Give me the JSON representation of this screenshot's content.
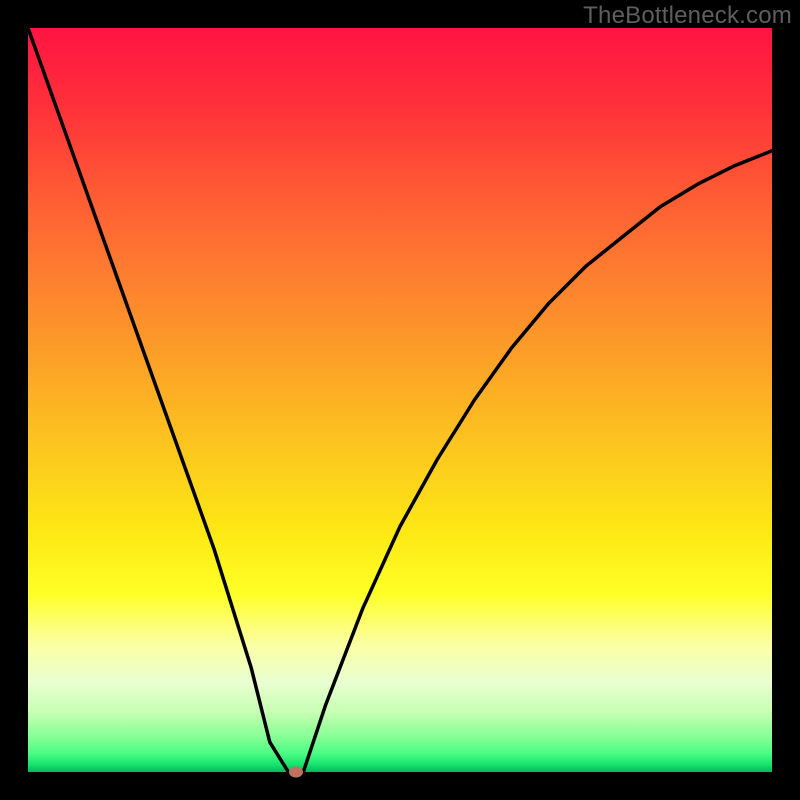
{
  "watermark": "TheBottleneck.com",
  "chart_data": {
    "type": "line",
    "title": "",
    "xlabel": "",
    "ylabel": "",
    "xlim": [
      0,
      1
    ],
    "ylim": [
      0,
      1
    ],
    "grid": false,
    "series": [
      {
        "name": "curve",
        "x": [
          0.0,
          0.05,
          0.1,
          0.15,
          0.2,
          0.25,
          0.3,
          0.325,
          0.35,
          0.36,
          0.37,
          0.4,
          0.45,
          0.5,
          0.55,
          0.6,
          0.65,
          0.7,
          0.75,
          0.8,
          0.85,
          0.9,
          0.95,
          1.0
        ],
        "values": [
          1.0,
          0.86,
          0.72,
          0.58,
          0.44,
          0.3,
          0.14,
          0.04,
          0.0,
          0.0,
          0.0,
          0.09,
          0.22,
          0.33,
          0.42,
          0.5,
          0.57,
          0.63,
          0.68,
          0.72,
          0.76,
          0.79,
          0.815,
          0.835
        ]
      }
    ],
    "marker": {
      "x": 0.36,
      "y": 0.0
    },
    "colors": {
      "curve": "#000000",
      "marker": "#c17162",
      "gradient_top": "#ff1442",
      "gradient_bottom": "#07b85a",
      "frame": "#000000"
    }
  }
}
